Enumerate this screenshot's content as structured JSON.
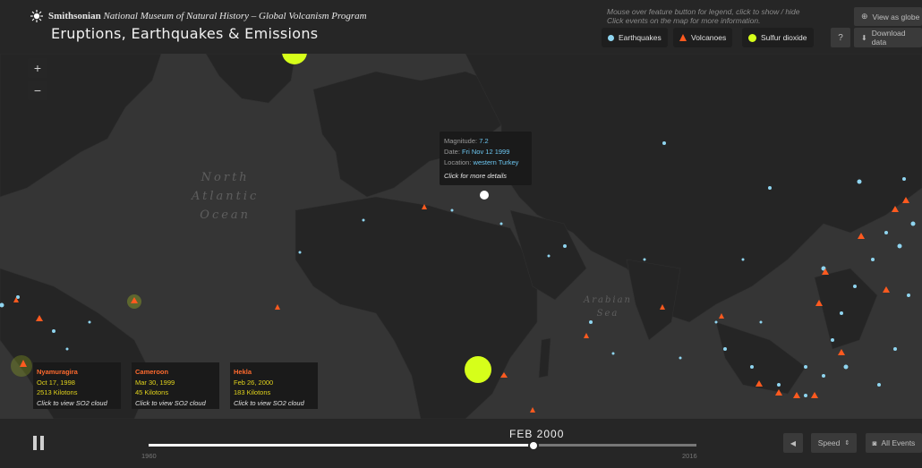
{
  "header": {
    "org_bold": "Smithsonian",
    "org_italic": "National Museum of Natural History – Global Volcanism Program",
    "title": "Eruptions, Earthquakes & Emissions",
    "hint_line1": "Mouse over feature button for legend, click to show / hide",
    "hint_line2": "Click events on the map for more information.",
    "view_globe": "View as globe",
    "download": "Download data",
    "help": "?"
  },
  "legend": {
    "earthquakes": "Earthquakes",
    "volcanoes": "Volcanoes",
    "sulfur": "Sulfur dioxide"
  },
  "map": {
    "zoom_in": "+",
    "zoom_out": "−",
    "ocean_north_atlantic": [
      "North",
      "Atlantic",
      "Ocean"
    ],
    "arabian_sea": [
      "Arabian",
      "Sea"
    ]
  },
  "tooltip": {
    "magnitude_label": "Magnitude:",
    "magnitude_value": "7.2",
    "date_label": "Date:",
    "date_value": "Fri Nov 12 1999",
    "location_label": "Location:",
    "location_value": "western Turkey",
    "click_hint": "Click for more details"
  },
  "emissions": [
    {
      "name": "Nyamuragira",
      "date": "Oct 17, 1998",
      "amount": "2513 Kilotons",
      "hint": "Click to view SO2 cloud"
    },
    {
      "name": "Cameroon",
      "date": "Mar 30, 1999",
      "amount": "45 Kilotons",
      "hint": "Click to view SO2 cloud"
    },
    {
      "name": "Hekla",
      "date": "Feb 26, 2000",
      "amount": "183 Kilotons",
      "hint": "Click to view SO2 cloud"
    }
  ],
  "timeline": {
    "current": "FEB 2000",
    "start": "1960",
    "end": "2016",
    "progress": 0.7
  },
  "controls": {
    "speed": "Speed",
    "all_events": "All Events"
  },
  "colors": {
    "earthquake": "#8fd5f0",
    "volcano": "#ff5a1f",
    "sulfur": "#d6ff1a"
  }
}
